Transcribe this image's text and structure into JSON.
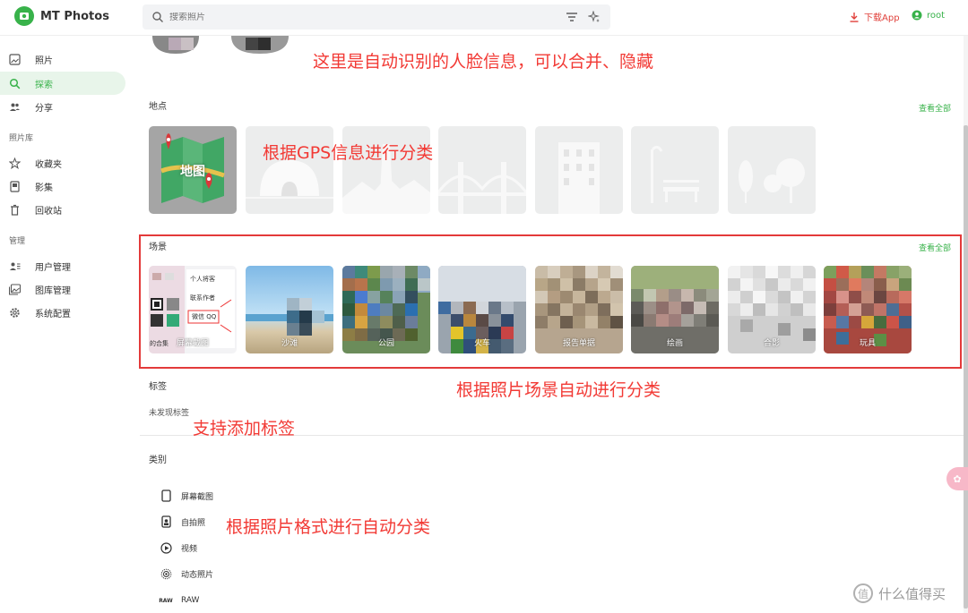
{
  "app": {
    "title": "MT Photos"
  },
  "search": {
    "placeholder": "搜索照片"
  },
  "header": {
    "download_label": "下载App",
    "user_name": "root"
  },
  "sidebar": {
    "items": [
      {
        "label": "照片",
        "icon": "photo-icon"
      },
      {
        "label": "探索",
        "icon": "search-icon",
        "active": true
      },
      {
        "label": "分享",
        "icon": "people-icon"
      }
    ],
    "library_section": "照片库",
    "library_items": [
      {
        "label": "收藏夹",
        "icon": "star-icon"
      },
      {
        "label": "影集",
        "icon": "album-icon"
      },
      {
        "label": "回收站",
        "icon": "trash-icon"
      }
    ],
    "manage_section": "管理",
    "manage_items": [
      {
        "label": "用户管理",
        "icon": "user-manage-icon"
      },
      {
        "label": "图库管理",
        "icon": "gallery-manage-icon"
      },
      {
        "label": "系统配置",
        "icon": "gear-icon"
      }
    ]
  },
  "places": {
    "title": "地点",
    "view_all": "查看全部",
    "map_label": "地图"
  },
  "scenes": {
    "title": "场景",
    "view_all": "查看全部",
    "items": [
      "屏幕截图",
      "沙滩",
      "公园",
      "火车",
      "报告单据",
      "绘画",
      "合影",
      "玩具"
    ],
    "screenshot_overlay": {
      "personal": "个人将客",
      "contact": "联系作者",
      "wechat": "微信 QQ",
      "corner": "的合集"
    }
  },
  "tags": {
    "title": "标签",
    "empty": "未发现标签"
  },
  "categories": {
    "title": "类别",
    "items": [
      {
        "label": "屏幕截图",
        "icon": "phone-icon"
      },
      {
        "label": "自拍照",
        "icon": "selfie-icon"
      },
      {
        "label": "视频",
        "icon": "play-icon"
      },
      {
        "label": "动态照片",
        "icon": "live-photo-icon"
      },
      {
        "label": "RAW",
        "icon": "raw-icon",
        "badge": "RAW"
      }
    ]
  },
  "annotations": {
    "faces": "这里是自动识别的人脸信息，可以合并、隐藏",
    "gps": "根据GPS信息进行分类",
    "scenes": "根据照片场景自动进行分类",
    "tags": "支持添加标签",
    "formats": "根据照片格式进行自动分类"
  },
  "watermark": "什么值得买",
  "colors": {
    "accent": "#38b24a",
    "annotation": "#f23a35",
    "download": "#e0403a"
  }
}
